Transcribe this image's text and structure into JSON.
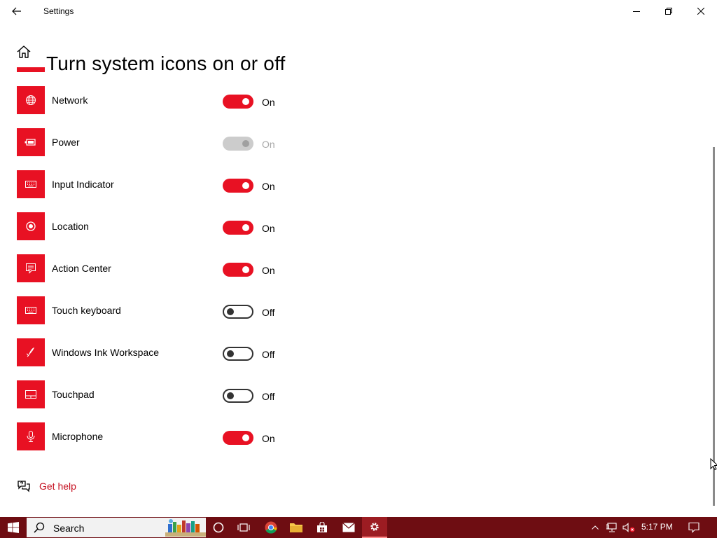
{
  "window": {
    "title": "Settings"
  },
  "page": {
    "title": "Turn system icons on or off"
  },
  "items": [
    {
      "label": "Network",
      "state": "On",
      "icon": "network-globe-icon",
      "status": "on"
    },
    {
      "label": "Power",
      "state": "On",
      "icon": "battery-icon",
      "status": "disabled"
    },
    {
      "label": "Input Indicator",
      "state": "On",
      "icon": "keyboard-icon",
      "status": "on"
    },
    {
      "label": "Location",
      "state": "On",
      "icon": "location-icon",
      "status": "on"
    },
    {
      "label": "Action Center",
      "state": "On",
      "icon": "action-center-icon",
      "status": "on"
    },
    {
      "label": "Touch keyboard",
      "state": "Off",
      "icon": "touch-keyboard-icon",
      "status": "off"
    },
    {
      "label": "Windows Ink Workspace",
      "state": "Off",
      "icon": "pen-icon",
      "status": "off"
    },
    {
      "label": "Touchpad",
      "state": "Off",
      "icon": "touchpad-icon",
      "status": "off"
    },
    {
      "label": "Microphone",
      "state": "On",
      "icon": "microphone-icon",
      "status": "on"
    }
  ],
  "help": {
    "label": "Get help"
  },
  "taskbar": {
    "search_placeholder": "Search",
    "time": "5:17 PM"
  },
  "colors": {
    "accent": "#e81123",
    "taskbar": "#6e0d12",
    "link": "#c50f1f"
  }
}
